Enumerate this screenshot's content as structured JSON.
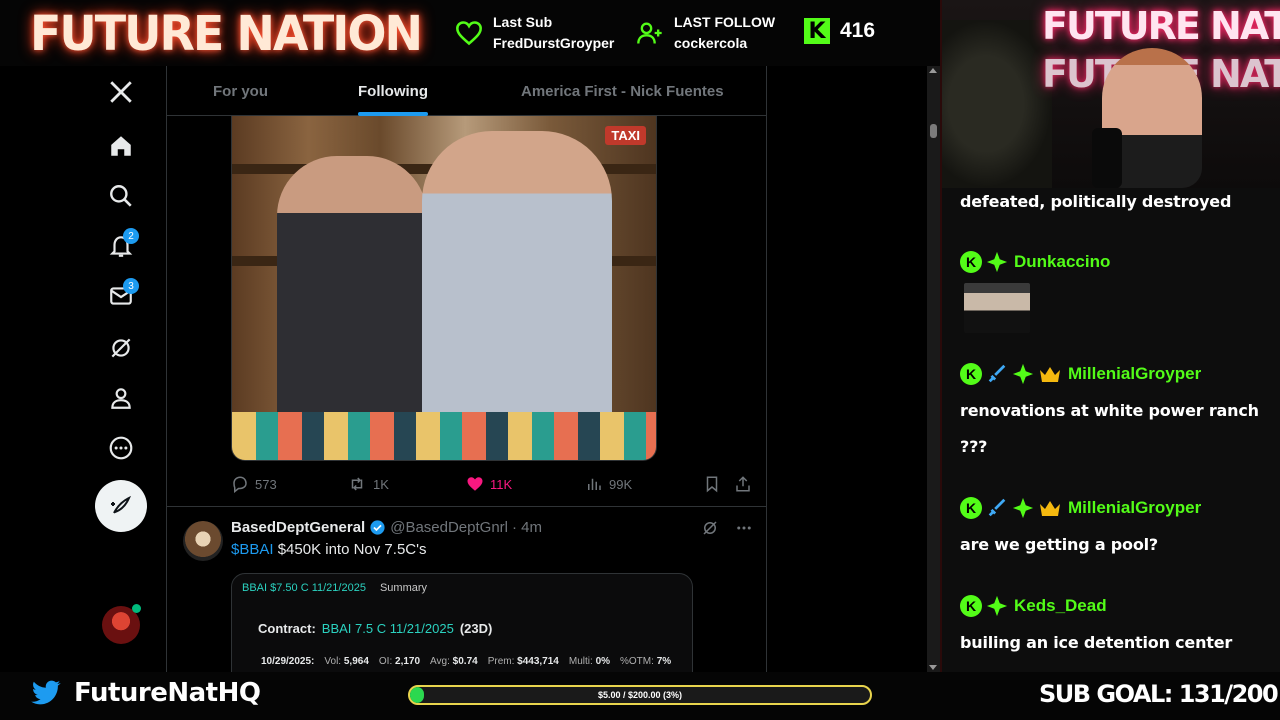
{
  "overlay": {
    "logo": "FUTURE NATION",
    "last_sub_label": "Last Sub",
    "last_sub_name": "FredDurstGroyper",
    "last_follow_label": "LAST FOLLOW",
    "last_follow_name": "cockercola",
    "kick_count": "416",
    "kick_logo": "K",
    "twitter_handle": "FutureNatHQ",
    "goal_text": "$5.00 / $200.00 (3%)",
    "goal_progress": 0.03,
    "sub_goal": "SUB GOAL: 131/200",
    "colors": {
      "kick_green": "#53fc18",
      "neon": "#ff3a1a",
      "goal_border": "#e8d44d"
    }
  },
  "x_nav": {
    "items": [
      {
        "icon": "x-logo-icon"
      },
      {
        "icon": "home-icon"
      },
      {
        "icon": "search-icon"
      },
      {
        "icon": "notifications-icon",
        "badge": "2"
      },
      {
        "icon": "messages-icon",
        "badge": "3"
      },
      {
        "icon": "grok-icon"
      },
      {
        "icon": "profile-icon"
      },
      {
        "icon": "more-icon"
      }
    ],
    "post_button_icon": "compose-icon"
  },
  "feed": {
    "tabs": [
      {
        "label": "For you"
      },
      {
        "label": "Following",
        "active": true
      },
      {
        "label": "America First - Nick Fuentes"
      }
    ],
    "tweet1": {
      "photo_sign": "TAXI",
      "replies": "573",
      "retweets": "1K",
      "likes": "11K",
      "views": "99K"
    },
    "tweet2": {
      "name": "BasedDeptGeneral",
      "handle": "@BasedDeptGnrl",
      "time": "· 4m",
      "cashtag": "$BBAI",
      "text": " $450K into Nov 7.5C's",
      "card": {
        "ticker": "BBAI $7.50 C 11/21/2025",
        "summary": "Summary",
        "contract_label": "Contract:",
        "contract_value": "BBAI 7.5 C 11/21/2025",
        "contract_days": "(23D)",
        "date": "10/29/2025:",
        "vol_label": "Vol:",
        "vol": "5,964",
        "oi_label": "OI:",
        "oi": "2,170",
        "avg_label": "Avg:",
        "avg": "$0.74",
        "prem_label": "Prem:",
        "prem": "$443,714",
        "multi_label": "Multi:",
        "multi": "0%",
        "otm_label": "%OTM:",
        "otm": "7%"
      }
    }
  },
  "chat": {
    "messages": [
      {
        "text": "defeated, politically destroyed"
      },
      {
        "user": "Dunkaccino",
        "badges": [
          "kick",
          "gem"
        ],
        "emote": true
      },
      {
        "user": "MillenialGroyper",
        "badges": [
          "kick",
          "sword",
          "gem",
          "crown"
        ],
        "text": "renovations at white power ranch ???"
      },
      {
        "user": "MillenialGroyper",
        "badges": [
          "kick",
          "sword",
          "gem",
          "crown"
        ],
        "text": "are we getting a pool?"
      },
      {
        "user": "Keds_Dead",
        "badges": [
          "kick",
          "gem"
        ],
        "text": "builing an ice detention center"
      }
    ]
  },
  "camera": {
    "neon_sign": "FUTURE NATION"
  }
}
